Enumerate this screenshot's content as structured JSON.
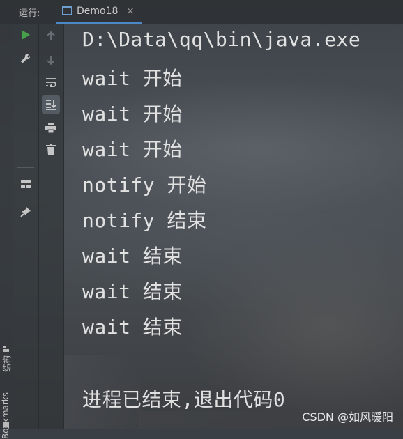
{
  "header": {
    "run_label": "运行:",
    "tab_name": "Demo18",
    "tab_close": "×"
  },
  "side_strip": {
    "structure_label": "结构",
    "bookmarks_label": "Bookmarks"
  },
  "toolbar": {
    "icons": [
      "run-icon",
      "settings-wrench-icon",
      "scroll-up-icon",
      "scroll-down-icon",
      "soft-wrap-icon",
      "scroll-to-end-icon",
      "print-icon",
      "trash-icon",
      "layout-icon",
      "pin-icon"
    ]
  },
  "console": {
    "lines": [
      "D:\\Data\\qq\\bin\\java.exe",
      "wait 开始",
      "wait 开始",
      "wait 开始",
      "notify 开始",
      "notify 结束",
      "wait 结束",
      "wait 结束",
      "wait 结束",
      "",
      "进程已结束,退出代码0"
    ]
  },
  "watermark": "CSDN @如风暖阳",
  "colors": {
    "accent": "#4a88c7",
    "run_green": "#49a04b",
    "console_text": "#e1e1e1"
  }
}
